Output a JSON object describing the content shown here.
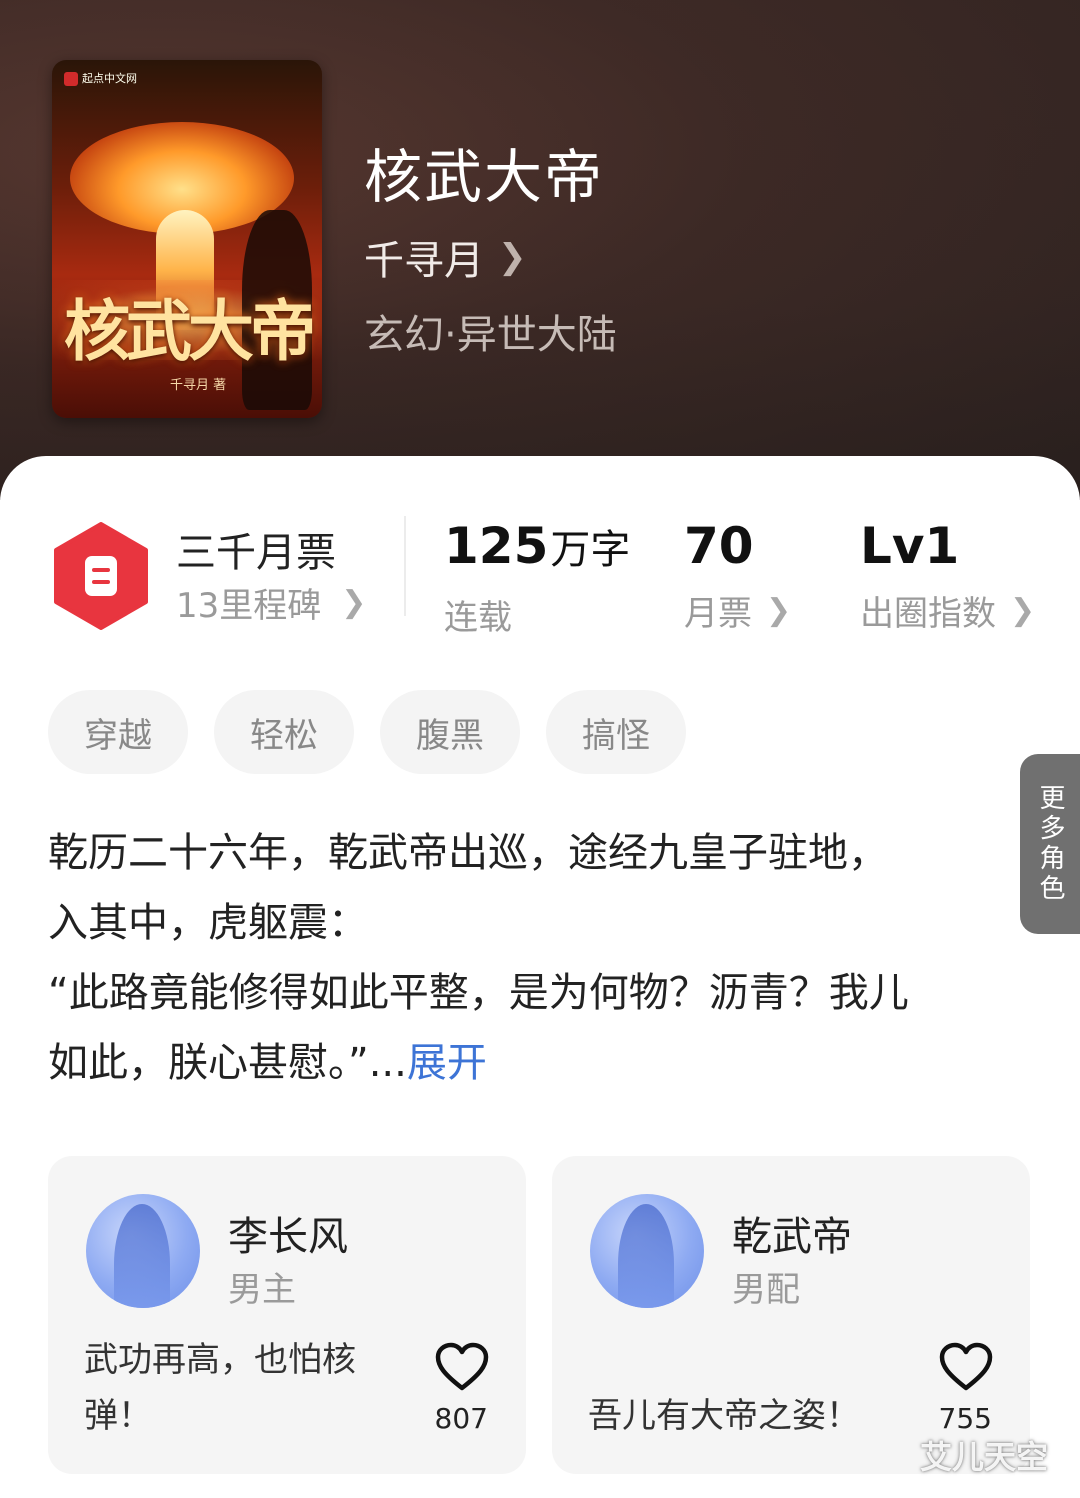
{
  "book": {
    "title": "核武大帝",
    "author": "千寻月",
    "genre": "玄幻·异世大陆",
    "cover": {
      "title": "核武大帝",
      "author": "千寻月 著",
      "publisher": "起点中文网"
    }
  },
  "ticket_stat": {
    "main": "三千月票",
    "sub": "13里程碑"
  },
  "stats": {
    "words": {
      "value": "125",
      "unit": "万字",
      "label": "连载"
    },
    "monthly_votes": {
      "value": "70",
      "label": "月票"
    },
    "popularity": {
      "value": "Lv1",
      "label": "出圈指数"
    }
  },
  "tags": [
    "穿越",
    "轻松",
    "腹黑",
    "搞怪"
  ],
  "description": {
    "line1": "乾历二十六年，乾武帝出巡，途经九皇子驻地，",
    "line2": "入其中，虎躯震：",
    "line3": "“此路竟能修得如此平整，是为何物？沥青？我儿",
    "line4": "如此，朕心甚慰。”...",
    "expand": "展开"
  },
  "characters": [
    {
      "name": "李长风",
      "role": "男主",
      "quote": "武功再高，也怕核弹！",
      "likes": "807"
    },
    {
      "name": "乾武帝",
      "role": "男配",
      "quote": "吾儿有大帝之姿！",
      "likes": "755"
    }
  ],
  "more_roles": "更多角色",
  "watermark": "艾儿天空",
  "colors": {
    "accent_red": "#e8353f",
    "link_blue": "#3d74d6"
  }
}
